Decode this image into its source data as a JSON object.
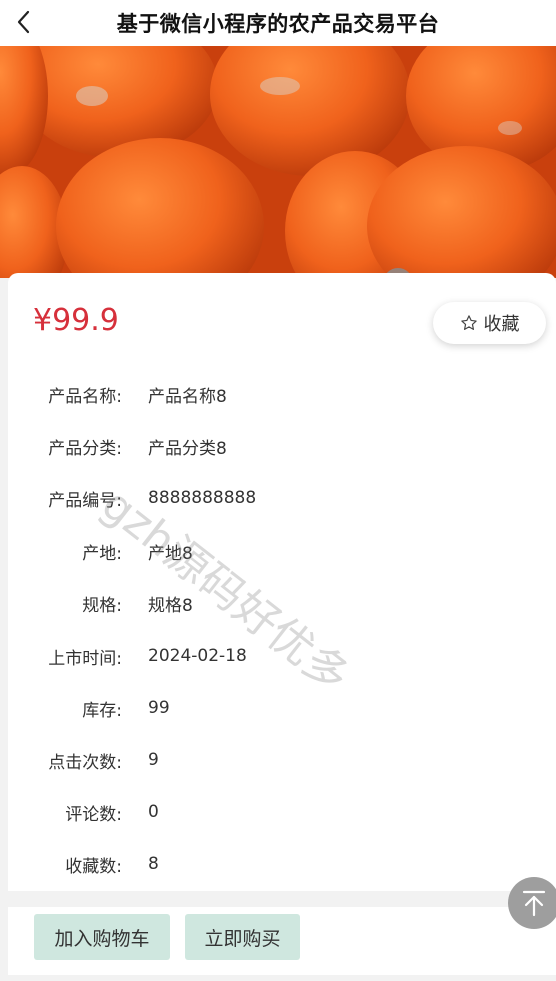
{
  "header": {
    "title": "基于微信小程序的农产品交易平台",
    "back_icon": "chevron-left-icon"
  },
  "hero": {
    "image": "persimmons-photo"
  },
  "product": {
    "price": "¥99.9",
    "favorite_label": "收藏",
    "favorite_icon": "star-outline-icon",
    "fields": [
      {
        "label": "产品名称:",
        "value": "产品名称8"
      },
      {
        "label": "产品分类:",
        "value": "产品分类8"
      },
      {
        "label": "产品编号:",
        "value": "8888888888"
      },
      {
        "label": "产地:",
        "value": "产地8"
      },
      {
        "label": "规格:",
        "value": "规格8"
      },
      {
        "label": "上市时间:",
        "value": "2024-02-18"
      },
      {
        "label": "库存:",
        "value": "99"
      },
      {
        "label": "点击次数:",
        "value": "9"
      },
      {
        "label": "评论数:",
        "value": "0"
      },
      {
        "label": "收藏数:",
        "value": "8"
      }
    ]
  },
  "watermark": "gzh源码好优多",
  "actions": {
    "add_to_cart": "加入购物车",
    "buy_now": "立即购买"
  },
  "colors": {
    "price": "#d6303b",
    "action_bg": "#cfe7df",
    "hero": "#e8561a"
  }
}
